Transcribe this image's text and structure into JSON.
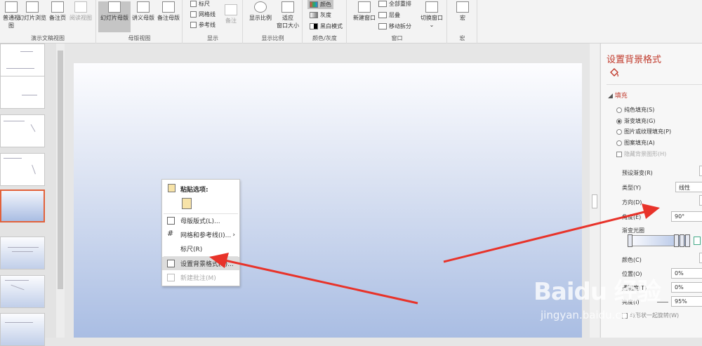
{
  "ribbon": {
    "presentation_views": {
      "group_label": "演示文稿视图",
      "buttons": [
        "普通视图",
        "幻灯片浏览",
        "备注页",
        "阅读视图"
      ]
    },
    "master_views": {
      "group_label": "母版视图",
      "buttons": [
        "幻灯片母版",
        "讲义母版",
        "备注母版"
      ]
    },
    "show": {
      "group_label": "显示",
      "checkboxes": [
        "标尺",
        "网格线",
        "参考线"
      ],
      "notes_button": "备注"
    },
    "zoom": {
      "group_label": "显示比例",
      "zoom_button": "显示比例",
      "fit_button": "适应\n窗口大小"
    },
    "color": {
      "group_label": "颜色/灰度",
      "options": [
        "颜色",
        "灰度",
        "黑白模式"
      ]
    },
    "window": {
      "group_label": "窗口",
      "new_window": "新建窗口",
      "options": [
        "全部重排",
        "层叠",
        "移动拆分"
      ],
      "switch": "切换窗口"
    },
    "macro": {
      "group_label": "宏",
      "button": "宏"
    }
  },
  "context_menu": {
    "paste_header": "粘贴选项:",
    "items": [
      "母版版式(L)...",
      "网格和参考线(I)...",
      "标尺(R)",
      "设置背景格式(B)...",
      "新建批注(M)"
    ]
  },
  "format_pane": {
    "title": "设置背景格式",
    "section": "填充",
    "fill_options": [
      "纯色填充(S)",
      "渐变填充(G)",
      "图片或纹理填充(P)",
      "图案填充(A)"
    ],
    "hide_background": "隐藏背景图形(H)",
    "preset_label": "预设渐变(R)",
    "type_label": "类型(Y)",
    "type_value": "线性",
    "direction_label": "方向(D)",
    "angle_label": "角度(E)",
    "angle_value": "90°",
    "stops_label": "渐变光圈",
    "color_label": "颜色(C)",
    "position_label": "位置(O)",
    "position_value": "0%",
    "transparency_label": "透明度(T)",
    "transparency_value": "0%",
    "brightness_label": "亮度(I)",
    "brightness_value": "95%",
    "rotate_label": "与形状一起旋转(W)"
  },
  "watermark": {
    "brand": "Baidu 经验",
    "url": "jingyan.baidu.com"
  },
  "colors": {
    "accent": "#c0392b",
    "selection": "#e2613a",
    "arrow": "#e8332a"
  }
}
